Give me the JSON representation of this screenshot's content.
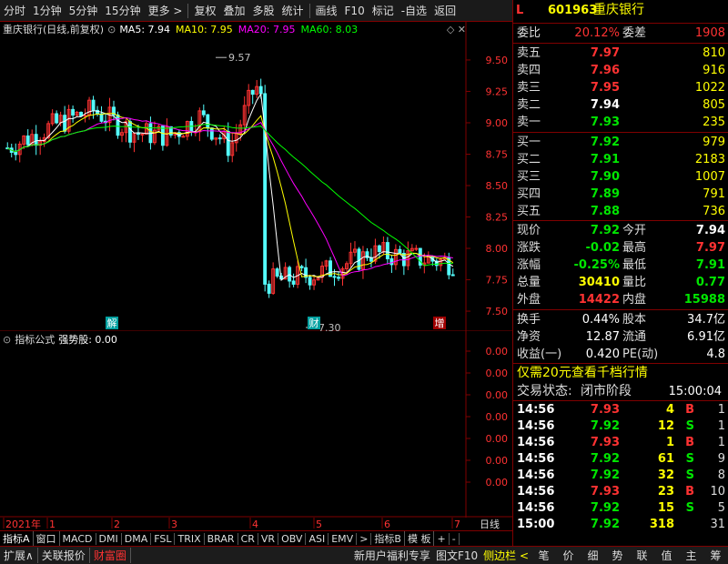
{
  "toolbar": {
    "items": [
      "分时",
      "1分钟",
      "5分钟",
      "15分钟",
      "更多 >",
      "复权",
      "叠加",
      "多股",
      "统计",
      "画线",
      "F10",
      "标记",
      "-自选",
      "返回"
    ]
  },
  "chart_info": {
    "title": "重庆银行(日线,前复权)",
    "ma5": "MA5: 7.94",
    "ma10": "MA10: 7.95",
    "ma20": "MA20: 7.95",
    "ma60": "MA60: 8.03",
    "colors": {
      "ma5": "#ffffff",
      "ma10": "#ffff00",
      "ma20": "#ff00ff",
      "ma60": "#00ff00"
    }
  },
  "chart_data": {
    "type": "candlestick",
    "title": "重庆银行(日线,前复权)",
    "y_ticks": [
      "9.50",
      "9.25",
      "9.00",
      "8.75",
      "8.50",
      "8.25",
      "8.00",
      "7.75",
      "7.50"
    ],
    "ylim": [
      7.37,
      9.63
    ],
    "high_label": "9.57",
    "low_label": "7.30",
    "event_markers": [
      "解",
      "财",
      "增"
    ],
    "x_ticks": [
      "2021年",
      "1",
      "2",
      "3",
      "4",
      "5",
      "6",
      "7"
    ],
    "up_color": "#ff3232",
    "down_color": "#54ffff",
    "series": [
      {
        "name": "MA5",
        "color": "#ffffff"
      },
      {
        "name": "MA10",
        "color": "#ffff00"
      },
      {
        "name": "MA20",
        "color": "#ff00ff"
      },
      {
        "name": "MA60",
        "color": "#00ff00"
      }
    ]
  },
  "sub_chart": {
    "label": "指标公式",
    "value": "强势股: 0.00",
    "y_ticks": [
      "0.00",
      "0.00",
      "0.00",
      "0.00",
      "0.00",
      "0.00",
      "0.00"
    ]
  },
  "period_label": "日线",
  "bottom_tabs": [
    "指标A",
    "窗口",
    "MACD",
    "DMI",
    "DMA",
    "FSL",
    "TRIX",
    "BRAR",
    "CR",
    "VR",
    "OBV",
    "ASI",
    "EMV",
    ">",
    "指标B",
    "模 板",
    "+",
    "-"
  ],
  "status_bar": {
    "left": [
      "扩展∧",
      "关联报价",
      "财富圈"
    ],
    "middle": [
      "新用户福利专享",
      "图文F10",
      "侧边栏 <"
    ],
    "right": [
      "笔",
      "价",
      "细",
      "势",
      "联",
      "值",
      "主",
      "筹"
    ]
  },
  "quote": {
    "code": "601963",
    "name": "重庆银行",
    "weibi_label": "委比",
    "weibi": "20.12%",
    "weicha_label": "委差",
    "weicha": "1908",
    "asks": [
      {
        "label": "卖五",
        "price": "7.97",
        "vol": "810",
        "color": "red"
      },
      {
        "label": "卖四",
        "price": "7.96",
        "vol": "916",
        "color": "red"
      },
      {
        "label": "卖三",
        "price": "7.95",
        "vol": "1022",
        "color": "red"
      },
      {
        "label": "卖二",
        "price": "7.94",
        "vol": "805",
        "color": "white"
      },
      {
        "label": "卖一",
        "price": "7.93",
        "vol": "235",
        "color": "green"
      }
    ],
    "bids": [
      {
        "label": "买一",
        "price": "7.92",
        "vol": "979",
        "color": "green"
      },
      {
        "label": "买二",
        "price": "7.91",
        "vol": "2183",
        "color": "green"
      },
      {
        "label": "买三",
        "price": "7.90",
        "vol": "1007",
        "color": "green"
      },
      {
        "label": "买四",
        "price": "7.89",
        "vol": "791",
        "color": "green"
      },
      {
        "label": "买五",
        "price": "7.88",
        "vol": "736",
        "color": "green"
      }
    ],
    "stats": [
      {
        "l1": "现价",
        "v1": "7.92",
        "c1": "green",
        "l2": "今开",
        "v2": "7.94",
        "c2": "white"
      },
      {
        "l1": "涨跌",
        "v1": "-0.02",
        "c1": "green",
        "l2": "最高",
        "v2": "7.97",
        "c2": "red"
      },
      {
        "l1": "涨幅",
        "v1": "-0.25%",
        "c1": "green",
        "l2": "最低",
        "v2": "7.91",
        "c2": "green"
      },
      {
        "l1": "总量",
        "v1": "30410",
        "c1": "yellow",
        "l2": "量比",
        "v2": "0.77",
        "c2": "green"
      },
      {
        "l1": "外盘",
        "v1": "14422",
        "c1": "red",
        "l2": "内盘",
        "v2": "15988",
        "c2": "green"
      }
    ],
    "stats2": [
      {
        "l1": "换手",
        "v1": "0.44%",
        "l2": "股本",
        "v2": "34.7亿"
      },
      {
        "l1": "净资",
        "v1": "12.87",
        "l2": "流通",
        "v2": "6.91亿"
      },
      {
        "l1": "收益(一)",
        "v1": "0.420",
        "l2": "PE(动)",
        "v2": "4.8"
      }
    ],
    "promo": "仅需20元查看千档行情",
    "trade_state_label": "交易状态:",
    "trade_state": "闭市阶段",
    "trade_time": "15:00:04",
    "ticks": [
      {
        "time": "14:56",
        "price": "7.93",
        "pc": "red",
        "vol": "4",
        "bs": "B",
        "n": "1"
      },
      {
        "time": "14:56",
        "price": "7.92",
        "pc": "green",
        "vol": "12",
        "bs": "S",
        "n": "1"
      },
      {
        "time": "14:56",
        "price": "7.93",
        "pc": "red",
        "vol": "1",
        "bs": "B",
        "n": "1"
      },
      {
        "time": "14:56",
        "price": "7.92",
        "pc": "green",
        "vol": "61",
        "bs": "S",
        "n": "9"
      },
      {
        "time": "14:56",
        "price": "7.92",
        "pc": "green",
        "vol": "32",
        "bs": "S",
        "n": "8"
      },
      {
        "time": "14:56",
        "price": "7.93",
        "pc": "red",
        "vol": "23",
        "bs": "B",
        "n": "10"
      },
      {
        "time": "14:56",
        "price": "7.92",
        "pc": "green",
        "vol": "15",
        "bs": "S",
        "n": "5"
      },
      {
        "time": "15:00",
        "price": "7.92",
        "pc": "green",
        "vol": "318",
        "bs": "",
        "n": "31"
      }
    ]
  }
}
